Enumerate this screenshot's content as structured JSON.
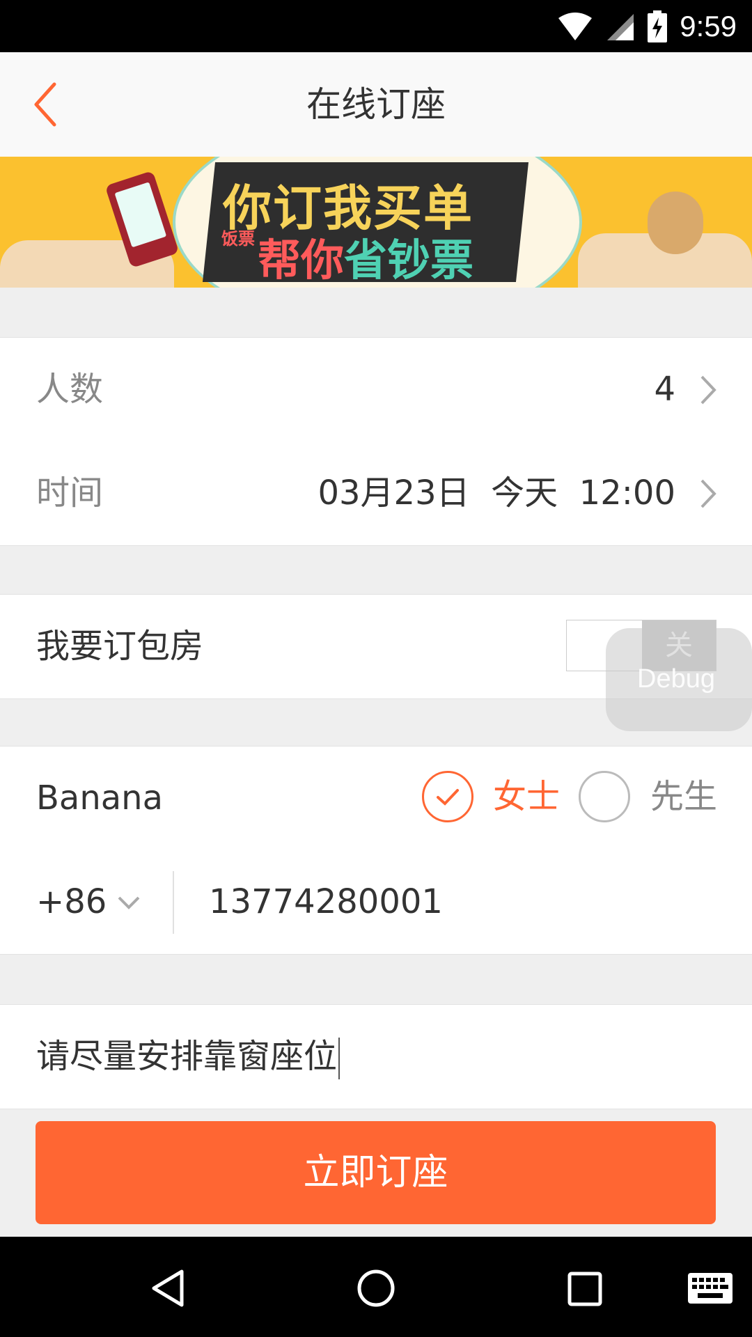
{
  "status_bar": {
    "time": "9:59",
    "icons": [
      "wifi-icon",
      "cellular-signal-icon",
      "battery-charging-icon"
    ]
  },
  "header": {
    "title": "在线订座",
    "back_icon": "chevron-left-icon"
  },
  "banner": {
    "line1": "你订我买单",
    "tag": "饭票",
    "line2a": "帮你",
    "line2b": "省钞票"
  },
  "form": {
    "people": {
      "label": "人数",
      "value": "4"
    },
    "time": {
      "label": "时间",
      "date": "03月23日",
      "day": "今天",
      "clock": "12:00"
    },
    "private_room": {
      "label": "我要订包房",
      "toggle_text": "关",
      "toggle_on": false
    },
    "name": {
      "value": "Banana",
      "gender_female": "女士",
      "gender_male": "先生",
      "selected": "女士"
    },
    "phone": {
      "country_code": "+86",
      "number": "13774280001"
    },
    "remark": {
      "value": "请尽量安排靠窗座位"
    }
  },
  "debug_overlay": {
    "label": "Debug"
  },
  "submit": {
    "label": "立即订座"
  },
  "colors": {
    "accent": "#ff6633",
    "background": "#efefef"
  }
}
